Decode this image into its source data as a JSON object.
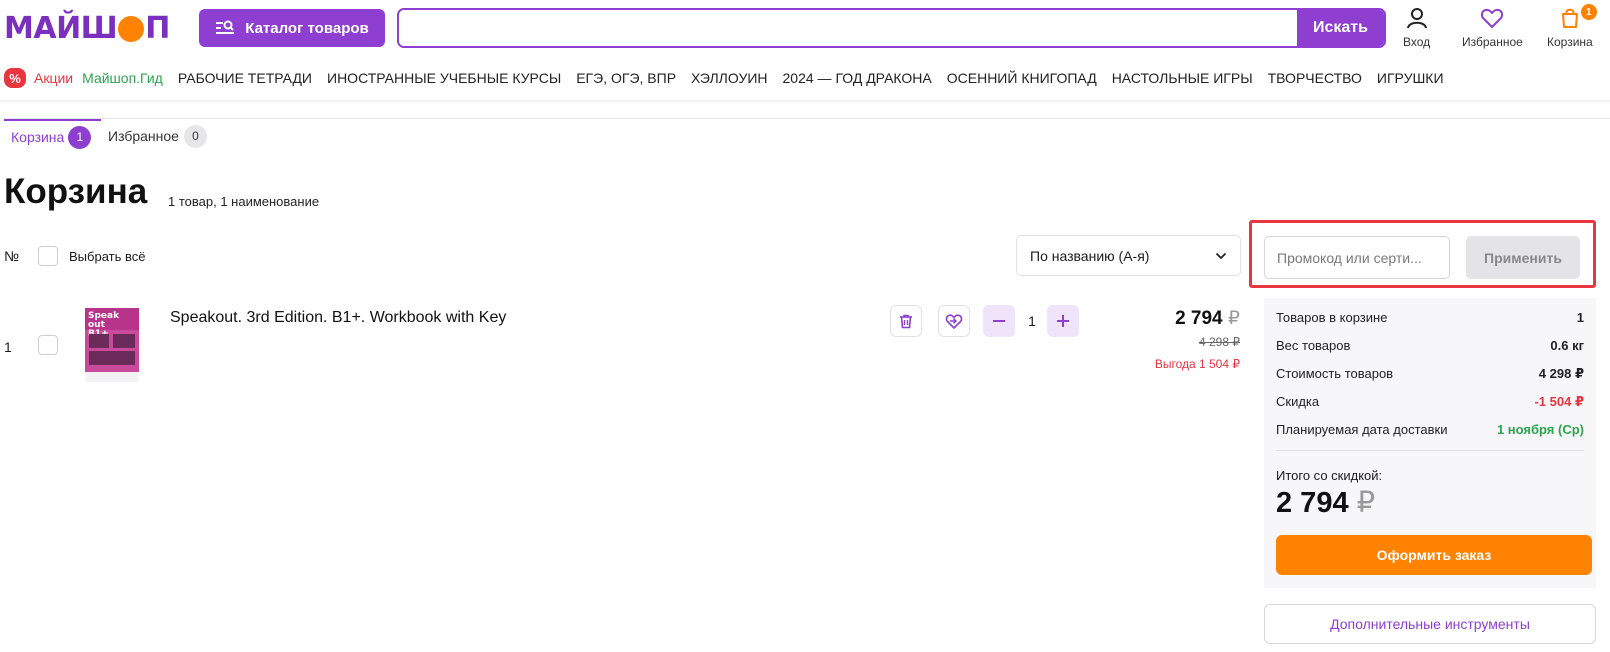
{
  "header": {
    "logo": "МАЙШОП",
    "catalog_label": "Каталог товаров",
    "search_placeholder": "",
    "search_button": "Искать",
    "login_label": "Вход",
    "favorites_label": "Избранное",
    "cart_label": "Корзина",
    "cart_count": "1"
  },
  "nav": {
    "percent": "%",
    "sale": "Акции",
    "guide": "Майшоп.Гид",
    "items": [
      "РАБОЧИЕ ТЕТРАДИ",
      "ИНОСТРАННЫЕ УЧЕБНЫЕ КУРСЫ",
      "ЕГЭ, ОГЭ, ВПР",
      "ХЭЛЛОУИН",
      "2024 — ГОД ДРАКОНА",
      "ОСЕННИЙ КНИГОПАД",
      "НАСТОЛЬНЫЕ ИГРЫ",
      "ТВОРЧЕСТВО",
      "ИГРУШКИ"
    ]
  },
  "tabs": {
    "cart_label": "Корзина",
    "cart_count": "1",
    "fav_label": "Избранное",
    "fav_count": "0"
  },
  "page": {
    "title": "Корзина",
    "subtitle": "1 товар, 1 наименование",
    "num_header": "№",
    "select_all": "Выбрать всё",
    "sort_value": "По названию (А-я)"
  },
  "item": {
    "number": "1",
    "cover_title": "Speak out",
    "cover_level": "B1+",
    "title": "Speakout. 3rd Edition. B1+. Workbook with Key",
    "quantity": "1",
    "price": "2 794",
    "currency": "₽",
    "old_price": "4 298 ₽",
    "savings": "Выгода 1 504 ₽"
  },
  "promo": {
    "placeholder": "Промокод или серти...",
    "apply_label": "Применить"
  },
  "summary": {
    "rows": [
      {
        "label": "Товаров в корзине",
        "value": "1"
      },
      {
        "label": "Вес товаров",
        "value": "0.6 кг"
      },
      {
        "label": "Стоимость товаров",
        "value": "4 298 ₽"
      },
      {
        "label": "Скидка",
        "value": "-1 504 ₽"
      },
      {
        "label": "Планируемая дата доставки",
        "value": "1 ноября (Ср)"
      }
    ],
    "total_label": "Итого со скидкой:",
    "total_value": "2 794",
    "currency": "₽",
    "order_label": "Оформить заказ",
    "tools_label": "Дополнительные инструменты"
  },
  "colors": {
    "brand_purple": "#8e3fd1",
    "brand_orange": "#ff8200",
    "sale_red": "#e8353f",
    "green": "#2ca44f"
  }
}
